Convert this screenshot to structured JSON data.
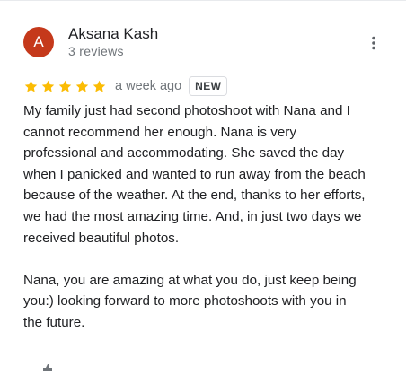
{
  "reviewer": {
    "avatar_letter": "A",
    "avatar_color": "#c5391b",
    "name": "Aksana Kash",
    "review_count": "3 reviews"
  },
  "rating": {
    "stars": 5,
    "max_stars": 5,
    "star_color": "#fbbc04",
    "date": "a week ago",
    "badge": "NEW"
  },
  "review": {
    "paragraph1_lines": [
      "My family just had second photoshoot with Nana and I",
      "cannot recommend her enough.  Nana is very",
      "professional and accommodating. She saved the day",
      "when I panicked and wanted to run away from the beach",
      "because of the weather. At the end, thanks to her efforts,",
      "we had the most amazing time.  And, in just two days we",
      "received beautiful photos."
    ],
    "paragraph2_lines": [
      "Nana, you are amazing at what you do, just keep being",
      "you:)  looking forward to more photoshoots with you in",
      "the future."
    ]
  },
  "icons": {
    "more": "more-vert-icon",
    "star": "star-icon"
  }
}
